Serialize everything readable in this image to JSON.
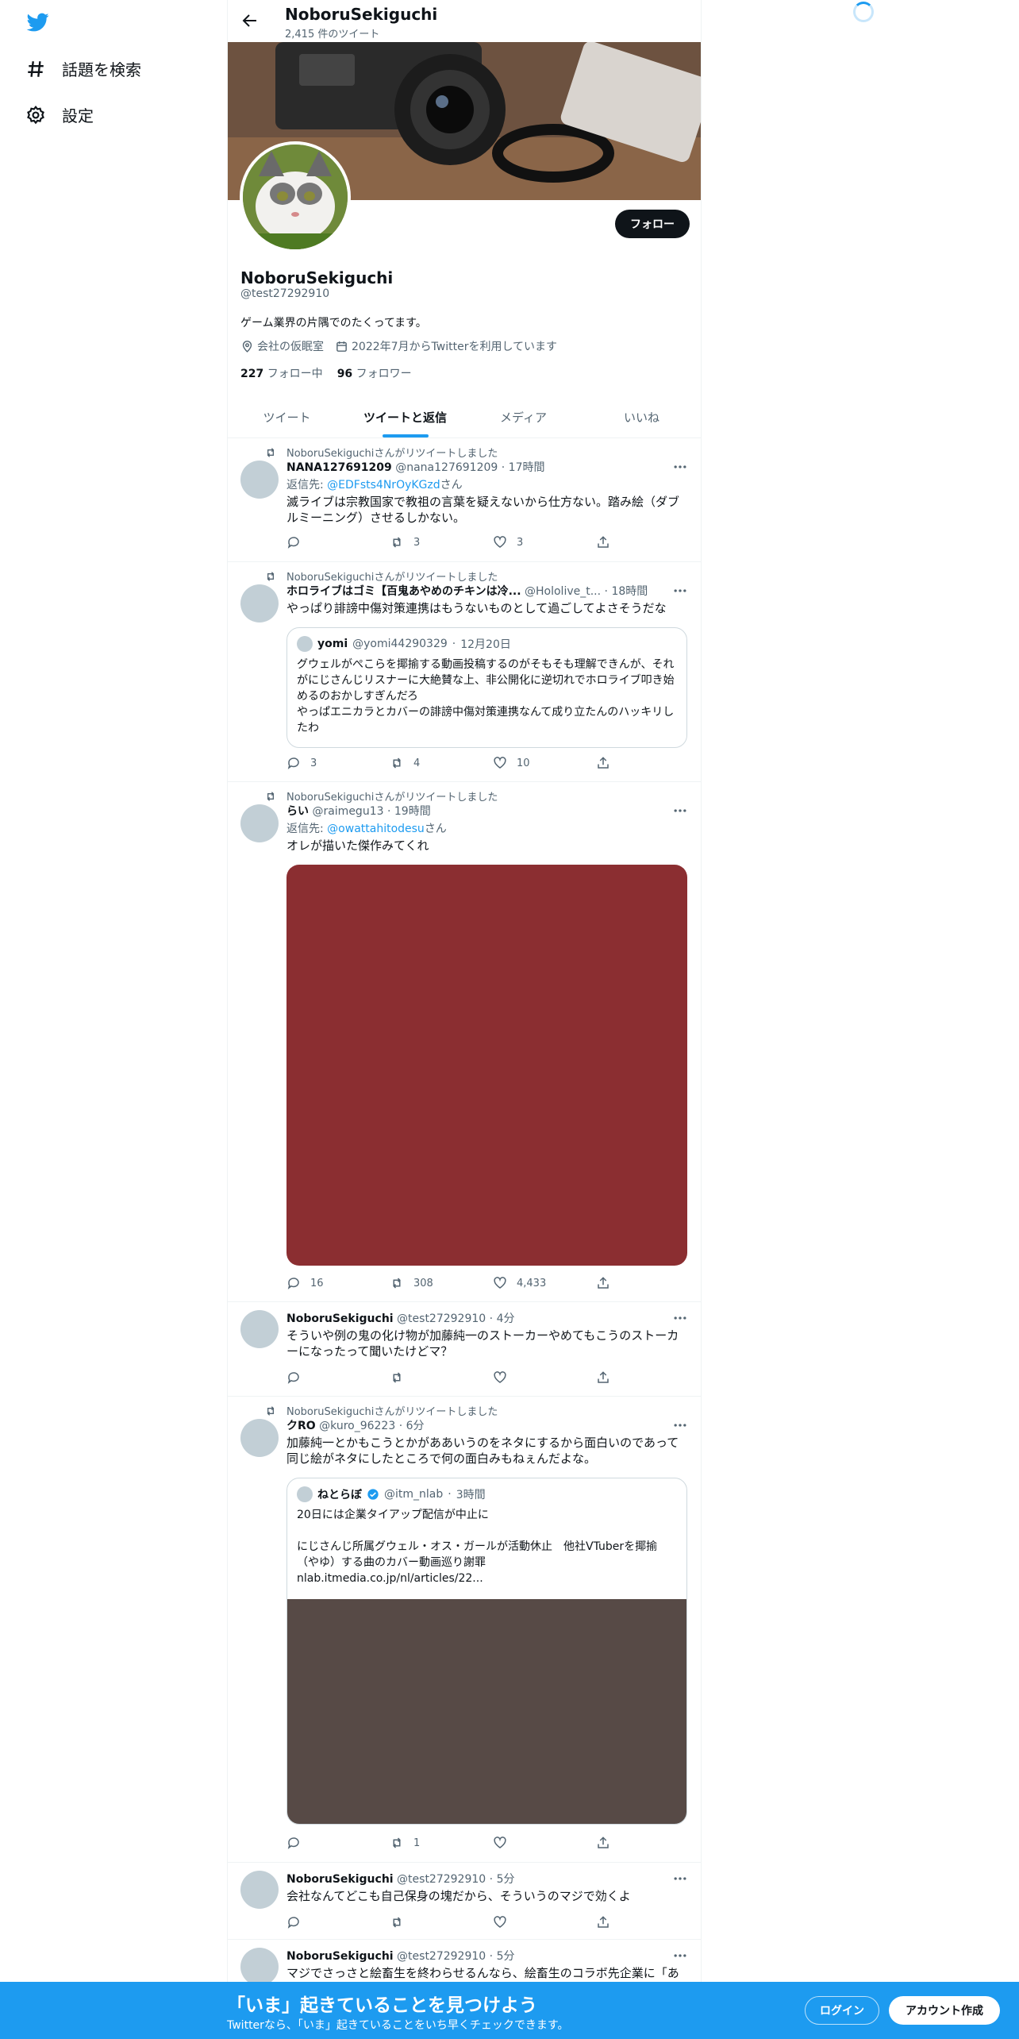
{
  "nav": {
    "explore": "話題を検索",
    "settings": "設定"
  },
  "header": {
    "name": "NoboruSekiguchi",
    "tweet_count": "2,415 件のツイート"
  },
  "profile": {
    "name": "NoboruSekiguchi",
    "handle": "@test27292910",
    "bio": "ゲーム業界の片隅でのたくってます。",
    "location": "会社の仮眠室",
    "joined": "2022年7月からTwitterを利用しています",
    "following_count": "227",
    "following_label": "フォロー中",
    "followers_count": "96",
    "followers_label": "フォロワー",
    "follow_button": "フォロー"
  },
  "tabs": [
    "ツイート",
    "ツイートと返信",
    "メディア",
    "いいね"
  ],
  "tweets": [
    {
      "retweeted_by": "NoboruSekiguchiさんがリツイートしました",
      "name": "NANA127691209",
      "handle": "@nana127691209",
      "time": "17時間",
      "reply_prefix": "返信先: ",
      "reply_to": "@EDFsts4NrOyKGzd",
      "reply_suffix": "さん",
      "text": "滅ライブは宗教国家で教祖の言葉を疑えないから仕方ない。踏み絵（ダブルミーニング）させるしかない。",
      "replies": "",
      "retweets": "3",
      "likes": "3"
    },
    {
      "retweeted_by": "NoboruSekiguchiさんがリツイートしました",
      "name": "ホロライブはゴミ【百鬼あやめのチキンは冷...",
      "handle": "@Hololive_t...",
      "time": "18時間",
      "text": "やっぱり誹謗中傷対策連携はもうないものとして過ごしてよさそうだな",
      "quote": {
        "name": "yomi",
        "handle": "@yomi44290329",
        "time": "12月20日",
        "text": "グウェルがぺこらを揶揄する動画投稿するのがそもそも理解できんが、それがにじさんじリスナーに大絶賛な上、非公開化に逆切れでホロライブ叩き始めるのおかしすぎんだろ\nやっぱエニカラとカバーの誹謗中傷対策連携なんて成り立たんのハッキリしたわ"
      },
      "replies": "3",
      "retweets": "4",
      "likes": "10"
    },
    {
      "retweeted_by": "NoboruSekiguchiさんがリツイートしました",
      "name": "らい",
      "handle": "@raimegu13",
      "time": "19時間",
      "reply_prefix": "返信先: ",
      "reply_to": "@owattahitodesu",
      "reply_suffix": "さん",
      "text": "オレが描いた傑作みてくれ",
      "media_color": "#8b2e31",
      "replies": "16",
      "retweets": "308",
      "likes": "4,433"
    },
    {
      "name": "NoboruSekiguchi",
      "handle": "@test27292910",
      "time": "4分",
      "text": "そういや例の鬼の化け物が加藤純一のストーカーやめてもこうのストーカーになったって聞いたけどマ？",
      "replies": "",
      "retweets": "",
      "likes": ""
    },
    {
      "retweeted_by": "NoboruSekiguchiさんがリツイートしました",
      "name": "クRO",
      "handle": "@kuro_96223",
      "time": "6分",
      "text": "加藤純一とかもこうとかがああいうのをネタにするから面白いのであって同じ絵がネタにしたところで何の面白みもねぇんだよな。",
      "quote": {
        "name": "ねとらぼ",
        "handle": "@itm_nlab",
        "time": "3時間",
        "text": "20日には企業タイアップ配信が中止に\n\nにじさんじ所属グウェル・オス・ガールが活動休止　他社VTuberを揶揄（やゆ）する曲のカバー動画巡り謝罪\nnlab.itmedia.co.jp/nl/articles/22...",
        "media_color": "#574a46"
      },
      "replies": "",
      "retweets": "1",
      "likes": ""
    },
    {
      "name": "NoboruSekiguchi",
      "handle": "@test27292910",
      "time": "5分",
      "text": "会社なんてどこも自己保身の塊だから、そういうのマジで効くよ",
      "replies": "",
      "retweets": "",
      "likes": ""
    },
    {
      "name": "NoboruSekiguchi",
      "handle": "@test27292910",
      "time": "5分",
      "text": "マジでさっさと絵畜生を終わらせるんなら、絵畜生のコラボ先企業に「あ"
    }
  ],
  "bottom_bar": {
    "title": "「いま」起きていることを見つけよう",
    "subtitle": "Twitterなら、「いま」起きていることをいち早くチェックできます。",
    "login": "ログイン",
    "signup": "アカウント作成"
  },
  "colors": {
    "accent": "#1d9bf0",
    "text": "#0f1419",
    "muted": "#536471"
  }
}
